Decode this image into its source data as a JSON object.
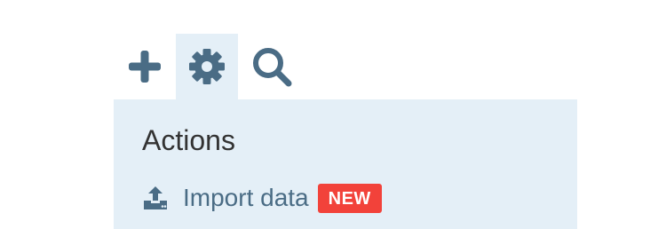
{
  "toolbar": {
    "buttons": [
      {
        "icon": "plus-icon",
        "active": false
      },
      {
        "icon": "gear-icon",
        "active": true
      },
      {
        "icon": "search-icon",
        "active": false
      }
    ]
  },
  "dropdown": {
    "title": "Actions",
    "items": [
      {
        "label": "Import data",
        "icon": "upload-icon",
        "badge": "NEW"
      }
    ]
  },
  "colors": {
    "icon": "#4a6c85",
    "panel_bg": "#e4eff7",
    "badge_bg": "#f2423a",
    "title_text": "#333333"
  }
}
